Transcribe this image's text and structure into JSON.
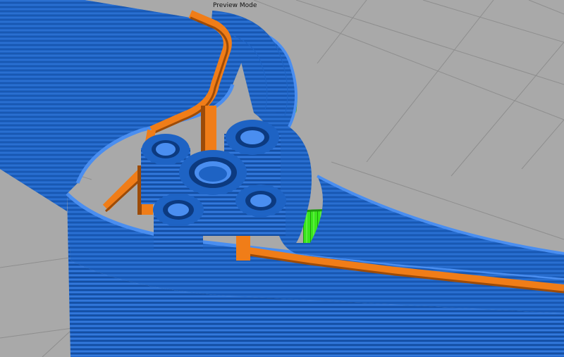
{
  "view": {
    "mode_label": "Preview Mode"
  },
  "colors": {
    "background": "#a9a9a9",
    "grid": "#8e8e8e",
    "outer_wall": "#1e63c4",
    "wall_highlight": "#4a8ef0",
    "wall_shadow": "#0c3a80",
    "inner_wall": "#f07d18",
    "inner_wall_shadow": "#9c4b08",
    "infill": "#39e61c",
    "infill_shadow": "#1e9a0e"
  },
  "legend_icons": [
    "outer-wall",
    "inner-wall",
    "infill",
    "support-boss"
  ]
}
